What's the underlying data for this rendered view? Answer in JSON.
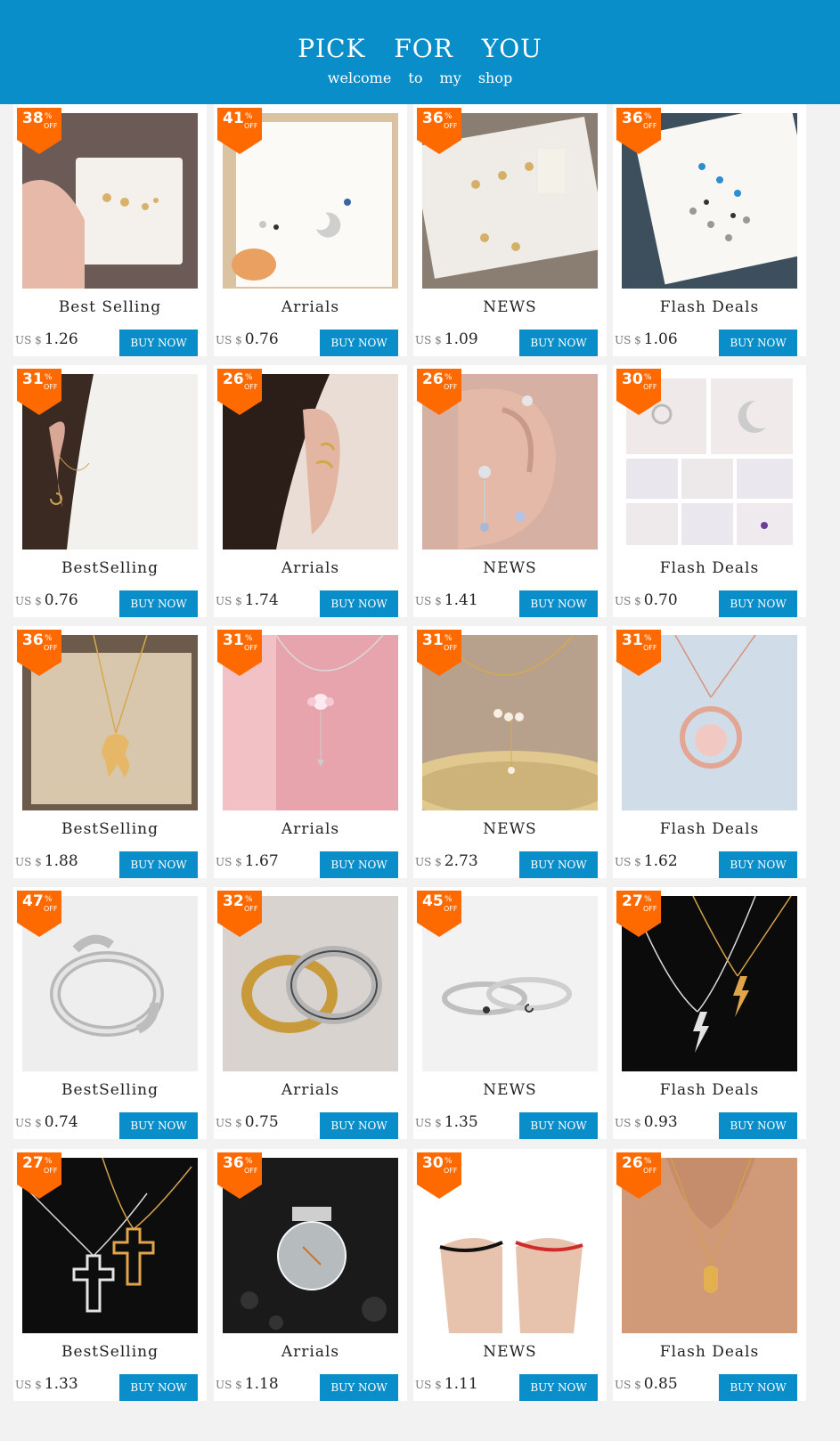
{
  "header": {
    "title": "PICK FOR YOU",
    "subtitle": "welcome to my shop"
  },
  "colors": {
    "accent": "#0a8ec9",
    "badge": "#ff6a00"
  },
  "currency": "US $",
  "buy_label": "BUY NOW",
  "percent_sign": "%",
  "off_label": "OFF",
  "products": [
    {
      "discount": "38",
      "category": "Best Selling",
      "price": "1.26",
      "image": "earring-card-butterflies"
    },
    {
      "discount": "41",
      "category": "Arrials",
      "price": "0.76",
      "image": "earring-card-moon-star"
    },
    {
      "discount": "36",
      "category": "NEWS",
      "price": "1.09",
      "image": "earring-card-flowers"
    },
    {
      "discount": "36",
      "category": "Flash Deals",
      "price": "1.06",
      "image": "earring-card-assorted-studs"
    },
    {
      "discount": "31",
      "category": "BestSelling",
      "price": "0.76",
      "image": "ear-chain-moon"
    },
    {
      "discount": "26",
      "category": "Arrials",
      "price": "1.74",
      "image": "ear-cuff-gold"
    },
    {
      "discount": "26",
      "category": "NEWS",
      "price": "1.41",
      "image": "butterfly-ear-crawlers"
    },
    {
      "discount": "30",
      "category": "Flash Deals",
      "price": "0.70",
      "image": "stud-collage"
    },
    {
      "discount": "36",
      "category": "BestSelling",
      "price": "1.88",
      "image": "unicorn-necklace"
    },
    {
      "discount": "31",
      "category": "Arrials",
      "price": "1.67",
      "image": "flower-necklace"
    },
    {
      "discount": "31",
      "category": "NEWS",
      "price": "2.73",
      "image": "pearl-moon-necklace"
    },
    {
      "discount": "31",
      "category": "Flash Deals",
      "price": "1.62",
      "image": "rose-gold-wreath-necklace"
    },
    {
      "discount": "47",
      "category": "BestSelling",
      "price": "0.74",
      "image": "hug-ring"
    },
    {
      "discount": "32",
      "category": "Arrials",
      "price": "0.75",
      "image": "couple-rings"
    },
    {
      "discount": "45",
      "category": "NEWS",
      "price": "1.35",
      "image": "sun-moon-rings"
    },
    {
      "discount": "27",
      "category": "Flash Deals",
      "price": "0.93",
      "image": "lightning-necklaces"
    },
    {
      "discount": "27",
      "category": "BestSelling",
      "price": "1.33",
      "image": "cross-necklaces"
    },
    {
      "discount": "36",
      "category": "Arrials",
      "price": "1.18",
      "image": "wish-dandelion-necklace"
    },
    {
      "discount": "30",
      "category": "NEWS",
      "price": "1.11",
      "image": "couple-bracelets"
    },
    {
      "discount": "26",
      "category": "Flash Deals",
      "price": "0.85",
      "image": "hamsa-necklace"
    }
  ]
}
